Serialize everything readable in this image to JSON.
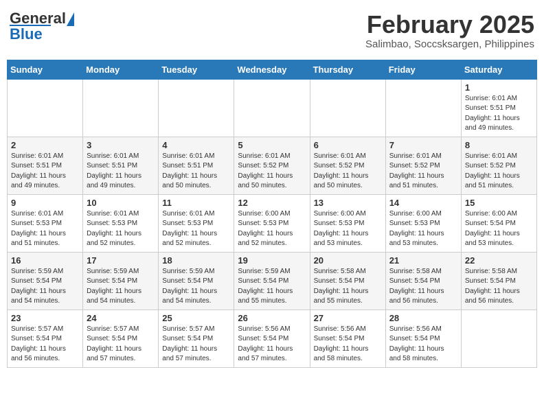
{
  "header": {
    "logo_general": "General",
    "logo_blue": "Blue",
    "month_title": "February 2025",
    "location": "Salimbao, Soccsksargen, Philippines"
  },
  "days_of_week": [
    "Sunday",
    "Monday",
    "Tuesday",
    "Wednesday",
    "Thursday",
    "Friday",
    "Saturday"
  ],
  "weeks": [
    [
      {
        "day": "",
        "info": ""
      },
      {
        "day": "",
        "info": ""
      },
      {
        "day": "",
        "info": ""
      },
      {
        "day": "",
        "info": ""
      },
      {
        "day": "",
        "info": ""
      },
      {
        "day": "",
        "info": ""
      },
      {
        "day": "1",
        "info": "Sunrise: 6:01 AM\nSunset: 5:51 PM\nDaylight: 11 hours\nand 49 minutes."
      }
    ],
    [
      {
        "day": "2",
        "info": "Sunrise: 6:01 AM\nSunset: 5:51 PM\nDaylight: 11 hours\nand 49 minutes."
      },
      {
        "day": "3",
        "info": "Sunrise: 6:01 AM\nSunset: 5:51 PM\nDaylight: 11 hours\nand 49 minutes."
      },
      {
        "day": "4",
        "info": "Sunrise: 6:01 AM\nSunset: 5:51 PM\nDaylight: 11 hours\nand 50 minutes."
      },
      {
        "day": "5",
        "info": "Sunrise: 6:01 AM\nSunset: 5:52 PM\nDaylight: 11 hours\nand 50 minutes."
      },
      {
        "day": "6",
        "info": "Sunrise: 6:01 AM\nSunset: 5:52 PM\nDaylight: 11 hours\nand 50 minutes."
      },
      {
        "day": "7",
        "info": "Sunrise: 6:01 AM\nSunset: 5:52 PM\nDaylight: 11 hours\nand 51 minutes."
      },
      {
        "day": "8",
        "info": "Sunrise: 6:01 AM\nSunset: 5:52 PM\nDaylight: 11 hours\nand 51 minutes."
      }
    ],
    [
      {
        "day": "9",
        "info": "Sunrise: 6:01 AM\nSunset: 5:53 PM\nDaylight: 11 hours\nand 51 minutes."
      },
      {
        "day": "10",
        "info": "Sunrise: 6:01 AM\nSunset: 5:53 PM\nDaylight: 11 hours\nand 52 minutes."
      },
      {
        "day": "11",
        "info": "Sunrise: 6:01 AM\nSunset: 5:53 PM\nDaylight: 11 hours\nand 52 minutes."
      },
      {
        "day": "12",
        "info": "Sunrise: 6:00 AM\nSunset: 5:53 PM\nDaylight: 11 hours\nand 52 minutes."
      },
      {
        "day": "13",
        "info": "Sunrise: 6:00 AM\nSunset: 5:53 PM\nDaylight: 11 hours\nand 53 minutes."
      },
      {
        "day": "14",
        "info": "Sunrise: 6:00 AM\nSunset: 5:53 PM\nDaylight: 11 hours\nand 53 minutes."
      },
      {
        "day": "15",
        "info": "Sunrise: 6:00 AM\nSunset: 5:54 PM\nDaylight: 11 hours\nand 53 minutes."
      }
    ],
    [
      {
        "day": "16",
        "info": "Sunrise: 5:59 AM\nSunset: 5:54 PM\nDaylight: 11 hours\nand 54 minutes."
      },
      {
        "day": "17",
        "info": "Sunrise: 5:59 AM\nSunset: 5:54 PM\nDaylight: 11 hours\nand 54 minutes."
      },
      {
        "day": "18",
        "info": "Sunrise: 5:59 AM\nSunset: 5:54 PM\nDaylight: 11 hours\nand 54 minutes."
      },
      {
        "day": "19",
        "info": "Sunrise: 5:59 AM\nSunset: 5:54 PM\nDaylight: 11 hours\nand 55 minutes."
      },
      {
        "day": "20",
        "info": "Sunrise: 5:58 AM\nSunset: 5:54 PM\nDaylight: 11 hours\nand 55 minutes."
      },
      {
        "day": "21",
        "info": "Sunrise: 5:58 AM\nSunset: 5:54 PM\nDaylight: 11 hours\nand 56 minutes."
      },
      {
        "day": "22",
        "info": "Sunrise: 5:58 AM\nSunset: 5:54 PM\nDaylight: 11 hours\nand 56 minutes."
      }
    ],
    [
      {
        "day": "23",
        "info": "Sunrise: 5:57 AM\nSunset: 5:54 PM\nDaylight: 11 hours\nand 56 minutes."
      },
      {
        "day": "24",
        "info": "Sunrise: 5:57 AM\nSunset: 5:54 PM\nDaylight: 11 hours\nand 57 minutes."
      },
      {
        "day": "25",
        "info": "Sunrise: 5:57 AM\nSunset: 5:54 PM\nDaylight: 11 hours\nand 57 minutes."
      },
      {
        "day": "26",
        "info": "Sunrise: 5:56 AM\nSunset: 5:54 PM\nDaylight: 11 hours\nand 57 minutes."
      },
      {
        "day": "27",
        "info": "Sunrise: 5:56 AM\nSunset: 5:54 PM\nDaylight: 11 hours\nand 58 minutes."
      },
      {
        "day": "28",
        "info": "Sunrise: 5:56 AM\nSunset: 5:54 PM\nDaylight: 11 hours\nand 58 minutes."
      },
      {
        "day": "",
        "info": ""
      }
    ]
  ]
}
